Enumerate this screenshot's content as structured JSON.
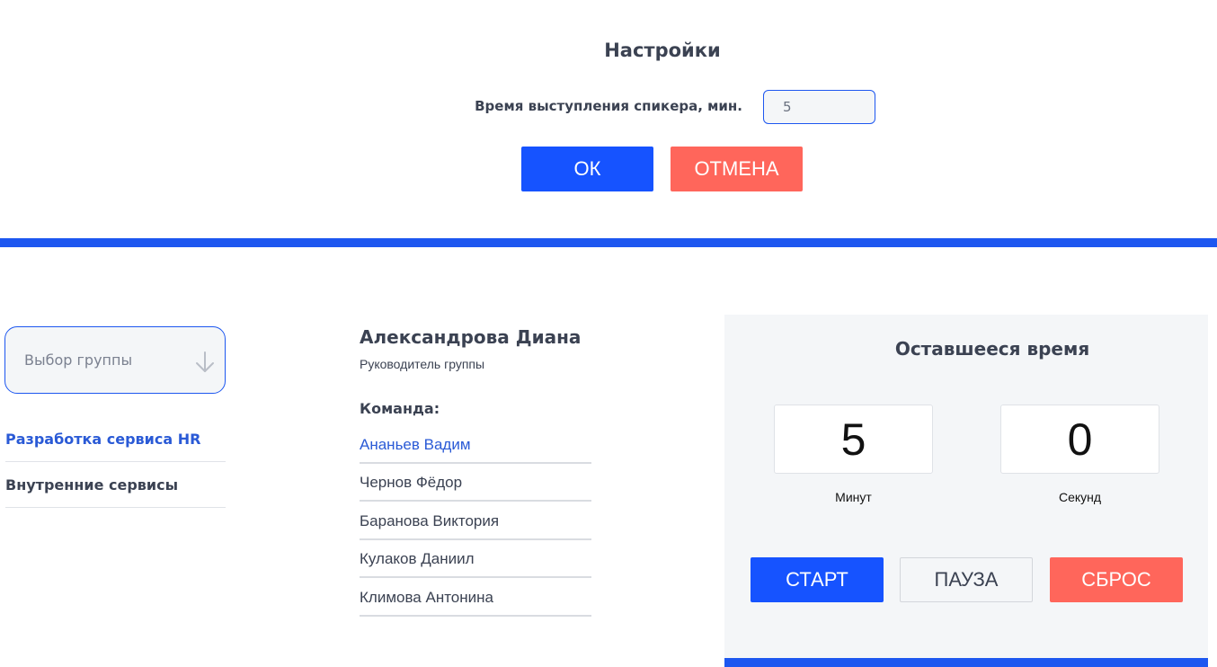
{
  "settings": {
    "title": "Настройки",
    "speaker_time_label": "Время выступления спикера, мин.",
    "speaker_time_value": "5",
    "ok_label": "ОК",
    "cancel_label": "ОТМЕНА"
  },
  "groups": {
    "select_placeholder": "Выбор группы",
    "items": [
      {
        "label": "Разработка сервиса HR",
        "active": true
      },
      {
        "label": "Внутренние сервисы",
        "active": false
      }
    ]
  },
  "team": {
    "leader_name": "Александрова Диана",
    "leader_role": "Руководитель группы",
    "team_label": "Команда:",
    "members": [
      {
        "name": "Ананьев Вадим",
        "active": true
      },
      {
        "name": "Чернов Фёдор",
        "active": false
      },
      {
        "name": "Баранова Виктория",
        "active": false
      },
      {
        "name": "Кулаков Даниил",
        "active": false
      },
      {
        "name": "Климова Антонина",
        "active": false
      }
    ]
  },
  "timer": {
    "title": "Оставшееся время",
    "minutes": "5",
    "seconds": "0",
    "minutes_label": "Минут",
    "seconds_label": "Секунд",
    "start_label": "СТАРТ",
    "pause_label": "ПАУЗА",
    "reset_label": "СБРОС"
  },
  "colors": {
    "primary": "#1653ff",
    "danger": "#ff665b",
    "active_text": "#2a5ad6"
  },
  "icons": {
    "group_select": "arrow-down-icon"
  }
}
